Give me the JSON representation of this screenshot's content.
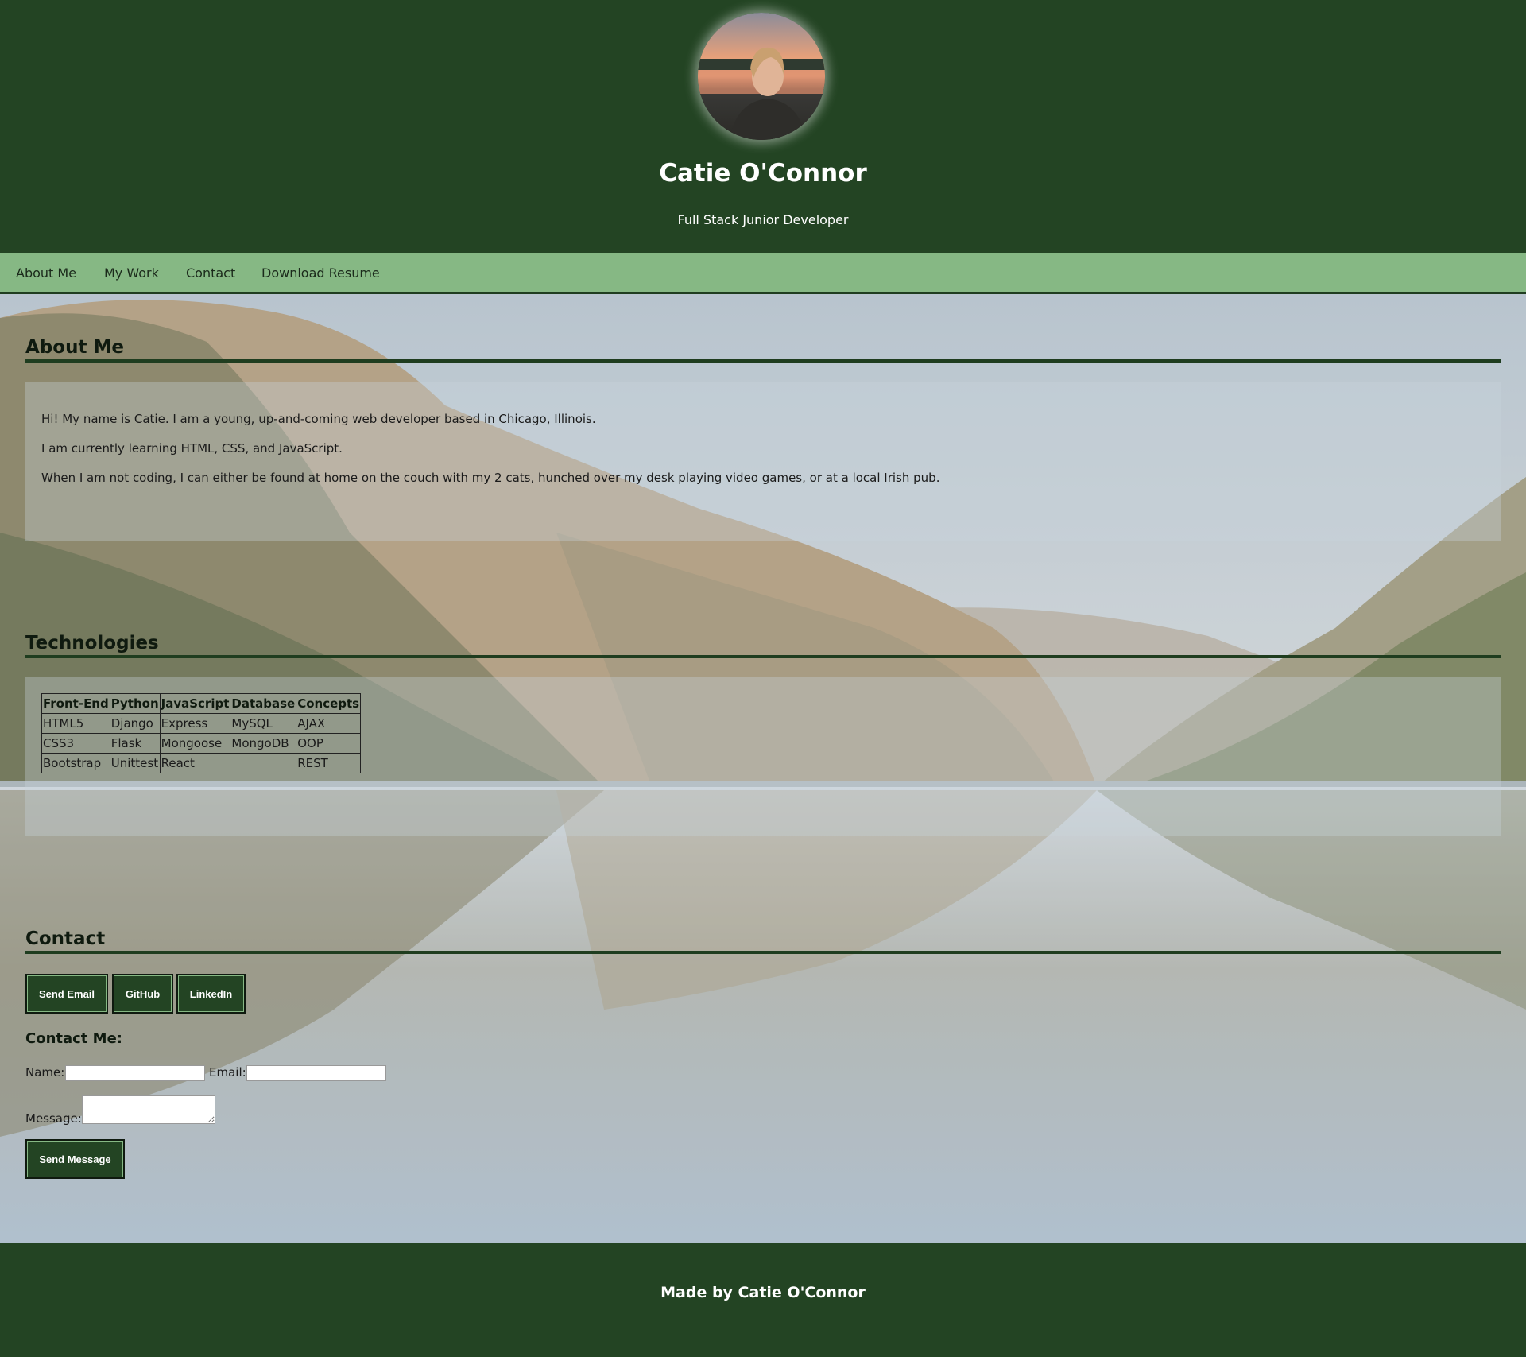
{
  "header": {
    "name": "Catie O'Connor",
    "subtitle": "Full Stack Junior Developer"
  },
  "nav": {
    "items": [
      "About Me",
      "My Work",
      "Contact",
      "Download Resume"
    ]
  },
  "about": {
    "title": "About Me",
    "paragraphs": [
      "Hi! My name is Catie. I am a young, up-and-coming web developer based in Chicago, Illinois.",
      "I am currently learning HTML, CSS, and JavaScript.",
      "When I am not coding, I can either be found at home on the couch with my 2 cats, hunched over my desk playing video games, or at a local Irish pub."
    ]
  },
  "technologies": {
    "title": "Technologies",
    "headers": [
      "Front-End",
      "Python",
      "JavaScript",
      "Database",
      "Concepts"
    ],
    "rows": [
      [
        "HTML5",
        "Django",
        "Express",
        "MySQL",
        "AJAX"
      ],
      [
        "CSS3",
        "Flask",
        "Mongoose",
        "MongoDB",
        "OOP"
      ],
      [
        "Bootstrap",
        "Unittest",
        "React",
        "",
        "REST"
      ]
    ]
  },
  "contact": {
    "title": "Contact",
    "buttons": [
      "Send Email",
      "GitHub",
      "LinkedIn"
    ],
    "form_title": "Contact Me:",
    "name_label": "Name:",
    "email_label": "Email:",
    "message_label": "Message:",
    "name_value": "",
    "email_value": "",
    "message_value": "",
    "submit_label": "Send Message"
  },
  "footer": {
    "text": "Made by Catie O'Connor"
  },
  "colors": {
    "header_bg": "#234423",
    "nav_bg": "#86b884",
    "accent_border": "#1f3d1f"
  }
}
